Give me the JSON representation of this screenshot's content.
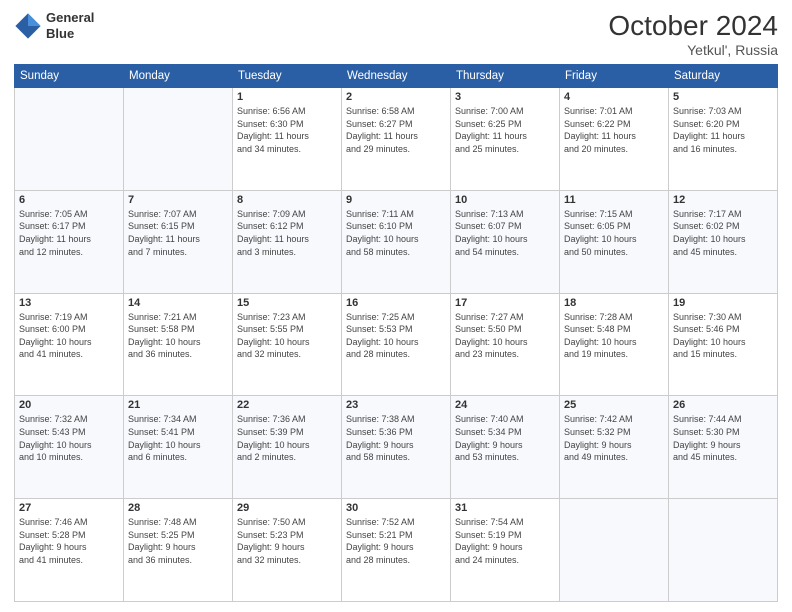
{
  "header": {
    "logo_line1": "General",
    "logo_line2": "Blue",
    "month": "October 2024",
    "location": "Yetkul', Russia"
  },
  "weekdays": [
    "Sunday",
    "Monday",
    "Tuesday",
    "Wednesday",
    "Thursday",
    "Friday",
    "Saturday"
  ],
  "weeks": [
    [
      {
        "day": "",
        "info": ""
      },
      {
        "day": "",
        "info": ""
      },
      {
        "day": "1",
        "info": "Sunrise: 6:56 AM\nSunset: 6:30 PM\nDaylight: 11 hours\nand 34 minutes."
      },
      {
        "day": "2",
        "info": "Sunrise: 6:58 AM\nSunset: 6:27 PM\nDaylight: 11 hours\nand 29 minutes."
      },
      {
        "day": "3",
        "info": "Sunrise: 7:00 AM\nSunset: 6:25 PM\nDaylight: 11 hours\nand 25 minutes."
      },
      {
        "day": "4",
        "info": "Sunrise: 7:01 AM\nSunset: 6:22 PM\nDaylight: 11 hours\nand 20 minutes."
      },
      {
        "day": "5",
        "info": "Sunrise: 7:03 AM\nSunset: 6:20 PM\nDaylight: 11 hours\nand 16 minutes."
      }
    ],
    [
      {
        "day": "6",
        "info": "Sunrise: 7:05 AM\nSunset: 6:17 PM\nDaylight: 11 hours\nand 12 minutes."
      },
      {
        "day": "7",
        "info": "Sunrise: 7:07 AM\nSunset: 6:15 PM\nDaylight: 11 hours\nand 7 minutes."
      },
      {
        "day": "8",
        "info": "Sunrise: 7:09 AM\nSunset: 6:12 PM\nDaylight: 11 hours\nand 3 minutes."
      },
      {
        "day": "9",
        "info": "Sunrise: 7:11 AM\nSunset: 6:10 PM\nDaylight: 10 hours\nand 58 minutes."
      },
      {
        "day": "10",
        "info": "Sunrise: 7:13 AM\nSunset: 6:07 PM\nDaylight: 10 hours\nand 54 minutes."
      },
      {
        "day": "11",
        "info": "Sunrise: 7:15 AM\nSunset: 6:05 PM\nDaylight: 10 hours\nand 50 minutes."
      },
      {
        "day": "12",
        "info": "Sunrise: 7:17 AM\nSunset: 6:02 PM\nDaylight: 10 hours\nand 45 minutes."
      }
    ],
    [
      {
        "day": "13",
        "info": "Sunrise: 7:19 AM\nSunset: 6:00 PM\nDaylight: 10 hours\nand 41 minutes."
      },
      {
        "day": "14",
        "info": "Sunrise: 7:21 AM\nSunset: 5:58 PM\nDaylight: 10 hours\nand 36 minutes."
      },
      {
        "day": "15",
        "info": "Sunrise: 7:23 AM\nSunset: 5:55 PM\nDaylight: 10 hours\nand 32 minutes."
      },
      {
        "day": "16",
        "info": "Sunrise: 7:25 AM\nSunset: 5:53 PM\nDaylight: 10 hours\nand 28 minutes."
      },
      {
        "day": "17",
        "info": "Sunrise: 7:27 AM\nSunset: 5:50 PM\nDaylight: 10 hours\nand 23 minutes."
      },
      {
        "day": "18",
        "info": "Sunrise: 7:28 AM\nSunset: 5:48 PM\nDaylight: 10 hours\nand 19 minutes."
      },
      {
        "day": "19",
        "info": "Sunrise: 7:30 AM\nSunset: 5:46 PM\nDaylight: 10 hours\nand 15 minutes."
      }
    ],
    [
      {
        "day": "20",
        "info": "Sunrise: 7:32 AM\nSunset: 5:43 PM\nDaylight: 10 hours\nand 10 minutes."
      },
      {
        "day": "21",
        "info": "Sunrise: 7:34 AM\nSunset: 5:41 PM\nDaylight: 10 hours\nand 6 minutes."
      },
      {
        "day": "22",
        "info": "Sunrise: 7:36 AM\nSunset: 5:39 PM\nDaylight: 10 hours\nand 2 minutes."
      },
      {
        "day": "23",
        "info": "Sunrise: 7:38 AM\nSunset: 5:36 PM\nDaylight: 9 hours\nand 58 minutes."
      },
      {
        "day": "24",
        "info": "Sunrise: 7:40 AM\nSunset: 5:34 PM\nDaylight: 9 hours\nand 53 minutes."
      },
      {
        "day": "25",
        "info": "Sunrise: 7:42 AM\nSunset: 5:32 PM\nDaylight: 9 hours\nand 49 minutes."
      },
      {
        "day": "26",
        "info": "Sunrise: 7:44 AM\nSunset: 5:30 PM\nDaylight: 9 hours\nand 45 minutes."
      }
    ],
    [
      {
        "day": "27",
        "info": "Sunrise: 7:46 AM\nSunset: 5:28 PM\nDaylight: 9 hours\nand 41 minutes."
      },
      {
        "day": "28",
        "info": "Sunrise: 7:48 AM\nSunset: 5:25 PM\nDaylight: 9 hours\nand 36 minutes."
      },
      {
        "day": "29",
        "info": "Sunrise: 7:50 AM\nSunset: 5:23 PM\nDaylight: 9 hours\nand 32 minutes."
      },
      {
        "day": "30",
        "info": "Sunrise: 7:52 AM\nSunset: 5:21 PM\nDaylight: 9 hours\nand 28 minutes."
      },
      {
        "day": "31",
        "info": "Sunrise: 7:54 AM\nSunset: 5:19 PM\nDaylight: 9 hours\nand 24 minutes."
      },
      {
        "day": "",
        "info": ""
      },
      {
        "day": "",
        "info": ""
      }
    ]
  ]
}
